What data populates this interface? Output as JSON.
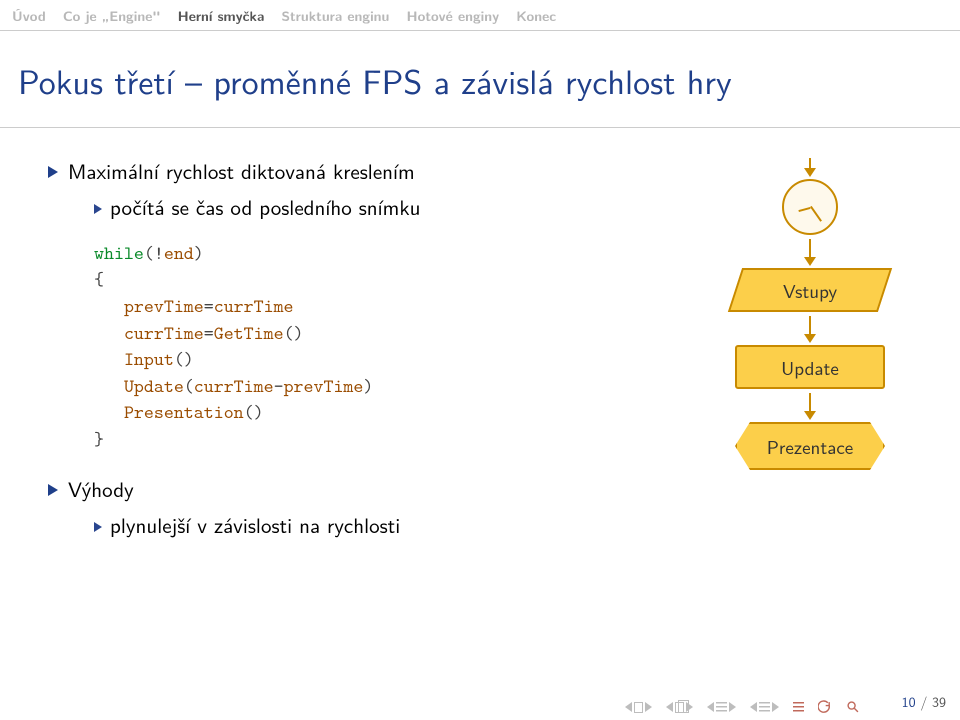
{
  "nav": {
    "items": [
      {
        "label": "Úvod",
        "active": false
      },
      {
        "label": "Co je „Engine\"",
        "active": false
      },
      {
        "label": "Herní smyčka",
        "active": true
      },
      {
        "label": "Struktura enginu",
        "active": false
      },
      {
        "label": "Hotové enginy",
        "active": false
      },
      {
        "label": "Konec",
        "active": false
      }
    ]
  },
  "title": "Pokus třetí – proměnné FPS a závislá rychlost hry",
  "bullets": {
    "b1": "Maximální rychlost diktovaná kreslením",
    "b1a": "počítá se čas od posledního snímku",
    "b2": "Výhody",
    "b2a": "plynulejší v závislosti na rychlosti"
  },
  "code": {
    "kw_while": "while",
    "seg_open": "(!",
    "lit_end": "end",
    "seg_close": ")",
    "brace_open": "{",
    "l1a": "prevTime",
    "l1eq": "=",
    "l1b": "currTime",
    "l2a": "currTime",
    "l2eq": "=",
    "l2b": "GetTime",
    "l2par": "()",
    "l3a": "Input",
    "l3par": "()",
    "l4a": "Update",
    "l4open": "(",
    "l4b": "currTime",
    "l4dash": "-",
    "l4c": "prevTime",
    "l4close": ")",
    "l5a": "Presentation",
    "l5par": "()",
    "brace_close": "}"
  },
  "flow": {
    "n2": "Vstupy",
    "n3": "Update",
    "n4": "Prezentace"
  },
  "footer": {
    "page": "10",
    "sep": " / ",
    "total": "39"
  }
}
